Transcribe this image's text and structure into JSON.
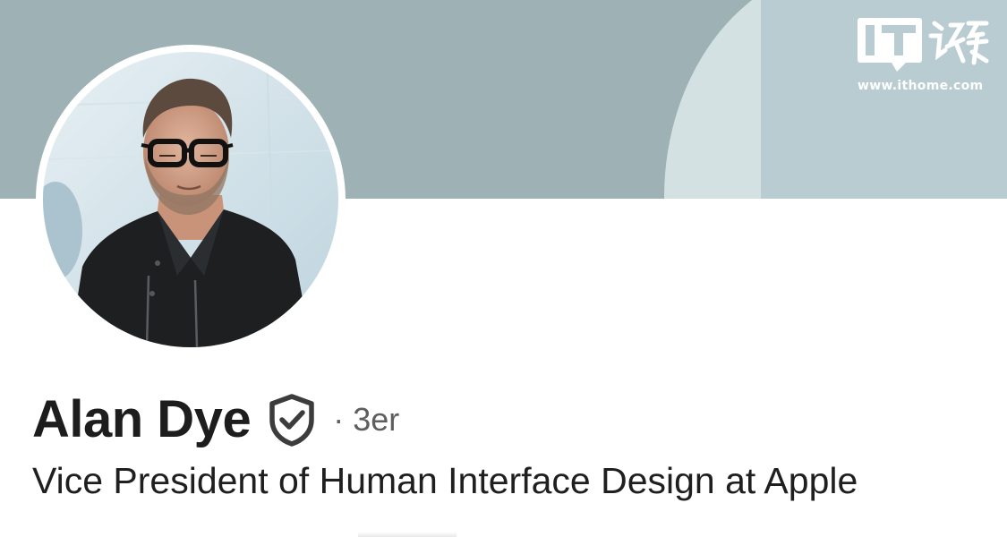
{
  "watermark": {
    "logo_icon": "ithome-logo-icon",
    "logo_text": "IT之家",
    "url": "www.ithome.com"
  },
  "profile": {
    "avatar_icon": "profile-photo",
    "name": "Alan Dye",
    "verified_icon": "verified-shield-icon",
    "separator": "·",
    "connection_degree": "3er",
    "headline": "Vice President of Human Interface Design at Apple"
  },
  "colors": {
    "cover_background": "#9eb1b5",
    "name_text": "#1d1d1d",
    "secondary_text": "#5e5e5e"
  }
}
